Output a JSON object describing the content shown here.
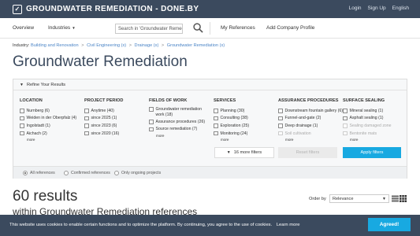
{
  "brand": {
    "name": "GROUNDWATER REMEDIATION - DONE.BY",
    "logo_icon": "check-square-icon"
  },
  "top_links": [
    "Login",
    "Sign Up",
    "English"
  ],
  "nav": {
    "overview": "Overview",
    "industries": "Industries",
    "search_value": "Search in 'Groundwater Remediation'",
    "my_references": "My References",
    "add_company_profile": "Add Company Profile"
  },
  "breadcrumb": {
    "label": "Industry:",
    "items": [
      "Building and Renovation",
      "Civil Engineering (x)",
      "Drainage (x)",
      "Groundwater Remediation (x)"
    ]
  },
  "page_title": "Groundwater Remediation",
  "filters": {
    "header": "Refine Your Results",
    "columns": [
      {
        "title": "LOCATION",
        "options": [
          "Nurnberg (6)",
          "Weiden in der Oberpfalz (4)",
          "Ingolstadt (1)",
          "Aichach (2)"
        ],
        "more": "more"
      },
      {
        "title": "PROJECT PERIOD",
        "options": [
          "Anytime (40)",
          "since 2025 (1)",
          "since 2023 (6)",
          "since 2020 (16)"
        ],
        "more": ""
      },
      {
        "title": "FIELDS OF WORK",
        "options": [
          "Groundwater remediation work (18)",
          "Assurance procedures (26)",
          "Source remediation (7)"
        ],
        "more": "more"
      },
      {
        "title": "SERVICES",
        "options": [
          "Planning (30)",
          "Consulting (38)",
          "Exploration (25)",
          "Monitoring (24)"
        ],
        "more": "more"
      },
      {
        "title": "ASSURANCE PROCEDURES",
        "options": [
          "Downstream fountain gallery (6)",
          "Funnel-and-gate (2)",
          "Deep drainage (1)",
          "Soil cultivation"
        ],
        "more": "more"
      },
      {
        "title": "SURFACE SEALING",
        "options": [
          "Mineral sealing (1)",
          "Asphalt sealing (1)",
          "Sealing damaged zone",
          "Bentonite mats"
        ],
        "more": "more"
      }
    ],
    "more_filters": "16 more filters",
    "reset": "Reset filters",
    "apply": "Apply filters",
    "ref_options": [
      "All references",
      "Confirmed references",
      "Only ongoing projects"
    ]
  },
  "results": {
    "count_text": "60 results",
    "subtitle": "within Groundwater Remediation references"
  },
  "order": {
    "label": "Order by",
    "value": "Relevance"
  },
  "cookie": {
    "text": "This website uses cookies to enable certain functions and to optimize the platform. By continuing, you agree to the use of cookies.",
    "learn_more": "Learn more",
    "agree": "Agreed!"
  },
  "colors": {
    "header_bg": "#3b4a5e",
    "accent": "#18a9e1",
    "link": "#4a84c6"
  }
}
